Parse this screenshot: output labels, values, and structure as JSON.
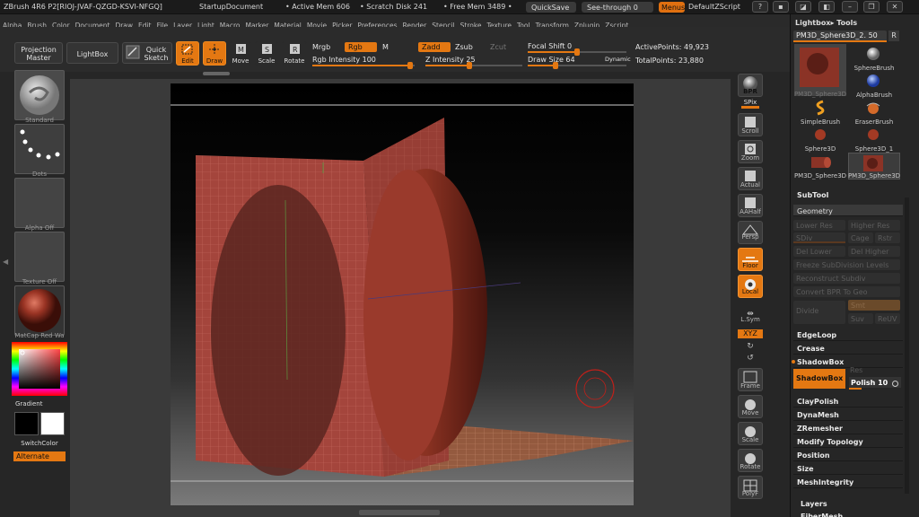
{
  "titlebar": {
    "app": "ZBrush 4R6 P2[RIOJ-JVAF-QZGD-KSVI-NFGQ]",
    "document": "StartupDocument",
    "active_mem": "• Active Mem 606",
    "scratch_disk": "• Scratch Disk 241",
    "free_mem": "• Free Mem 3489 •",
    "quicksave": "QuickSave",
    "see_through": "See-through  0",
    "menus": "Menus",
    "default_zscript": "DefaultZScript"
  },
  "menu": [
    "Alpha",
    "Brush",
    "Color",
    "Document",
    "Draw",
    "Edit",
    "File",
    "Layer",
    "Light",
    "Macro",
    "Marker",
    "Material",
    "Movie",
    "Picker",
    "Preferences",
    "Render",
    "Stencil",
    "Stroke",
    "Texture",
    "Tool",
    "Transform",
    "Zplugin",
    "Zscript"
  ],
  "toolbar": {
    "projection_master": "Projection Master",
    "lightbox": "LightBox",
    "quick_sketch": "Quick Sketch",
    "edit": "Edit",
    "draw": "Draw",
    "move": "Move",
    "scale": "Scale",
    "rotate": "Rotate",
    "mrgb": "Mrgb",
    "rgb": "Rgb",
    "m": "M",
    "zadd": "Zadd",
    "zsub": "Zsub",
    "zcut": "Zcut",
    "rgb_intensity": "Rgb Intensity 100",
    "z_intensity": "Z Intensity 25",
    "focal_shift": "Focal Shift 0",
    "draw_size": "Draw Size 64",
    "dynamic": "Dynamic",
    "active_points": "ActivePoints: 49,923",
    "total_points": "TotalPoints: 23,880"
  },
  "left_shelf": {
    "brush": "Standard",
    "stroke": "Dots",
    "alpha": "Alpha Off",
    "texture": "Texture Off",
    "material": "MatCap Red Wa",
    "gradient": "Gradient",
    "switch_color": "SwitchColor",
    "alternate": "Alternate"
  },
  "right_shelf": [
    "BPR",
    "SPix",
    "Scroll",
    "Zoom",
    "Actual",
    "AAHalf",
    "Persp",
    "Floor",
    "Local",
    "L.Sym",
    "XYZ",
    "Frame",
    "Move",
    "Scale",
    "Rotate",
    "PolyF"
  ],
  "tool_panel": {
    "header": "Lightbox▸ Tools",
    "current_tool": "PM3D_Sphere3D_2. 50",
    "r_button": "R",
    "tools": [
      "PM3D_Sphere3D",
      "SphereBrush",
      "AlphaBrush",
      "SimpleBrush",
      "EraserBrush",
      "Sphere3D",
      "Sphere3D_1",
      "PM3D_Sphere3D",
      "PM3D_Sphere3D"
    ],
    "subtool": "SubTool",
    "geometry": "Geometry",
    "geo_buttons": [
      "Lower Res",
      "Higher Res",
      "SDiv",
      "Cage",
      "Rstr",
      "Del Lower",
      "Del Higher",
      "Freeze SubDivision Levels",
      "Reconstruct Subdiv",
      "Convert BPR To Geo",
      "Divide",
      "Smt",
      "Suv",
      "ReUV"
    ],
    "sections": [
      "EdgeLoop",
      "Crease",
      "ShadowBox",
      "ClayPolish",
      "DynaMesh",
      "ZRemesher",
      "Modify Topology",
      "Position",
      "Size",
      "MeshIntegrity"
    ],
    "shadowbox_button": "ShadowBox",
    "res_label": "Res",
    "polish": "Polish 10",
    "layers": "Layers",
    "fiber_mesh": "FiberMesh"
  },
  "colors": {
    "accent": "#e47812",
    "object": "#8a3327",
    "panel": "#262626"
  }
}
